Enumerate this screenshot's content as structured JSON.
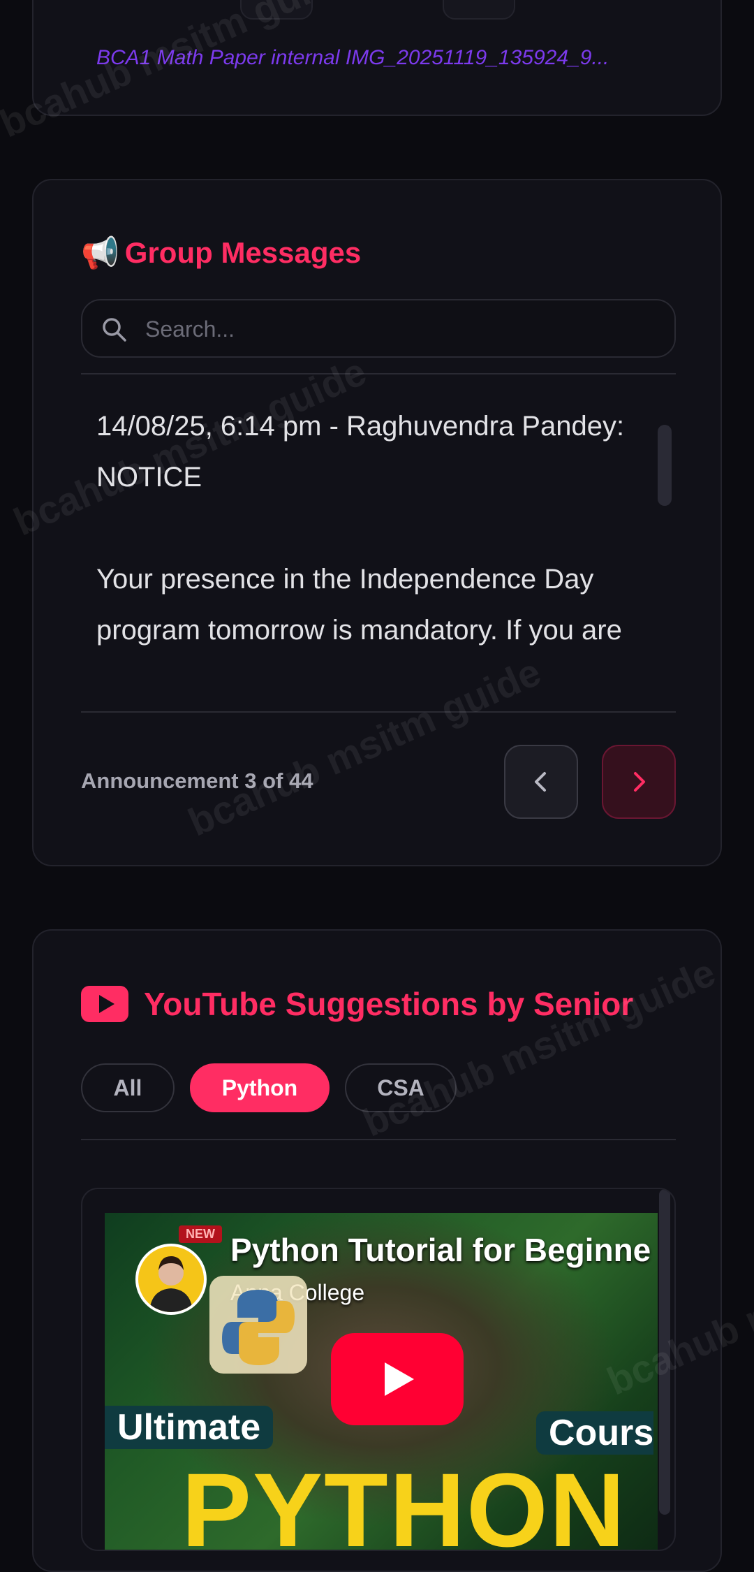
{
  "top_card": {
    "file_link": "BCA1 Math Paper internal IMG_20251119_135924_9..."
  },
  "group_messages": {
    "icon": "megaphone-icon",
    "title_emoji": "📢",
    "title": "Group Messages",
    "search_placeholder": "Search...",
    "message": "14/08/25, 6:14 pm - Raghuvendra Pandey: NOTICE\n\nYour presence in the Independence Day program tomorrow is mandatory. If you are absent, you will have to pay a",
    "counter": "Announcement 3 of 44"
  },
  "youtube": {
    "icon": "youtube-icon",
    "title": "YouTube Suggestions by Senior",
    "chips": [
      {
        "label": "All",
        "active": false
      },
      {
        "label": "Python",
        "active": true
      },
      {
        "label": "CSA",
        "active": false
      }
    ],
    "video": {
      "title": "Python Tutorial for Beginne",
      "channel": "Apna College",
      "badge": "NEW",
      "thumb_text_1": "Ultimate",
      "thumb_text_2": "Cours",
      "thumb_text_3": "PYTHON"
    }
  },
  "watermark": "bcahub msitm guide",
  "colors": {
    "accent": "#ff2d63",
    "link": "#7c3aed",
    "background": "#0b0b10",
    "card": "#111118"
  }
}
